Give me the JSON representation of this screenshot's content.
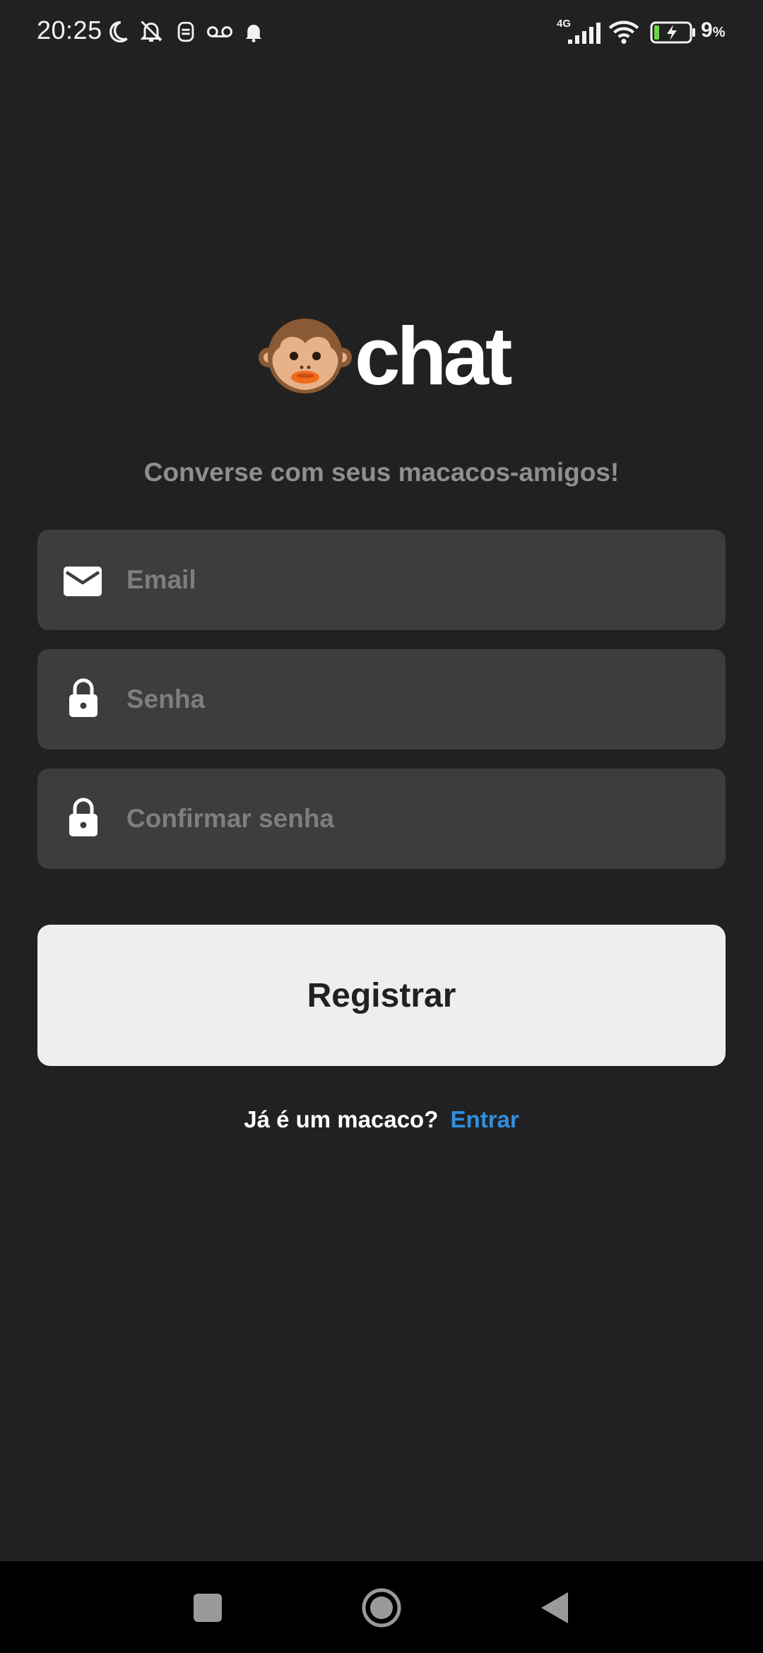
{
  "status_bar": {
    "time": "20:25",
    "network_type": "4G",
    "battery_percent": "9",
    "battery_unit": "%",
    "icons": [
      "moon-icon",
      "bell-off-icon",
      "alien-icon",
      "voicemail-icon",
      "bell-icon",
      "signal-icon",
      "wifi-icon",
      "battery-charging-icon"
    ]
  },
  "logo": {
    "emoji_icon": "monkey-face-icon",
    "text": "chat"
  },
  "tagline": "Converse com seus macacos-amigos!",
  "form": {
    "email": {
      "placeholder": "Email",
      "value": "",
      "icon": "mail-icon"
    },
    "password": {
      "placeholder": "Senha",
      "value": "",
      "icon": "lock-icon"
    },
    "confirm_password": {
      "placeholder": "Confirmar senha",
      "value": "",
      "icon": "lock-icon"
    }
  },
  "register_button": "Registrar",
  "login_prompt": {
    "text": "Já é um macaco?",
    "link": "Entrar"
  },
  "nav_bar": {
    "buttons": [
      "recents-square-icon",
      "home-circle-icon",
      "back-triangle-icon"
    ]
  },
  "colors": {
    "background": "#212121",
    "field_background": "#3d3d3d",
    "button_background": "#eeeeee",
    "link": "#2f8fe0",
    "placeholder": "#7e7e7e",
    "tagline": "#8f8f8f"
  }
}
